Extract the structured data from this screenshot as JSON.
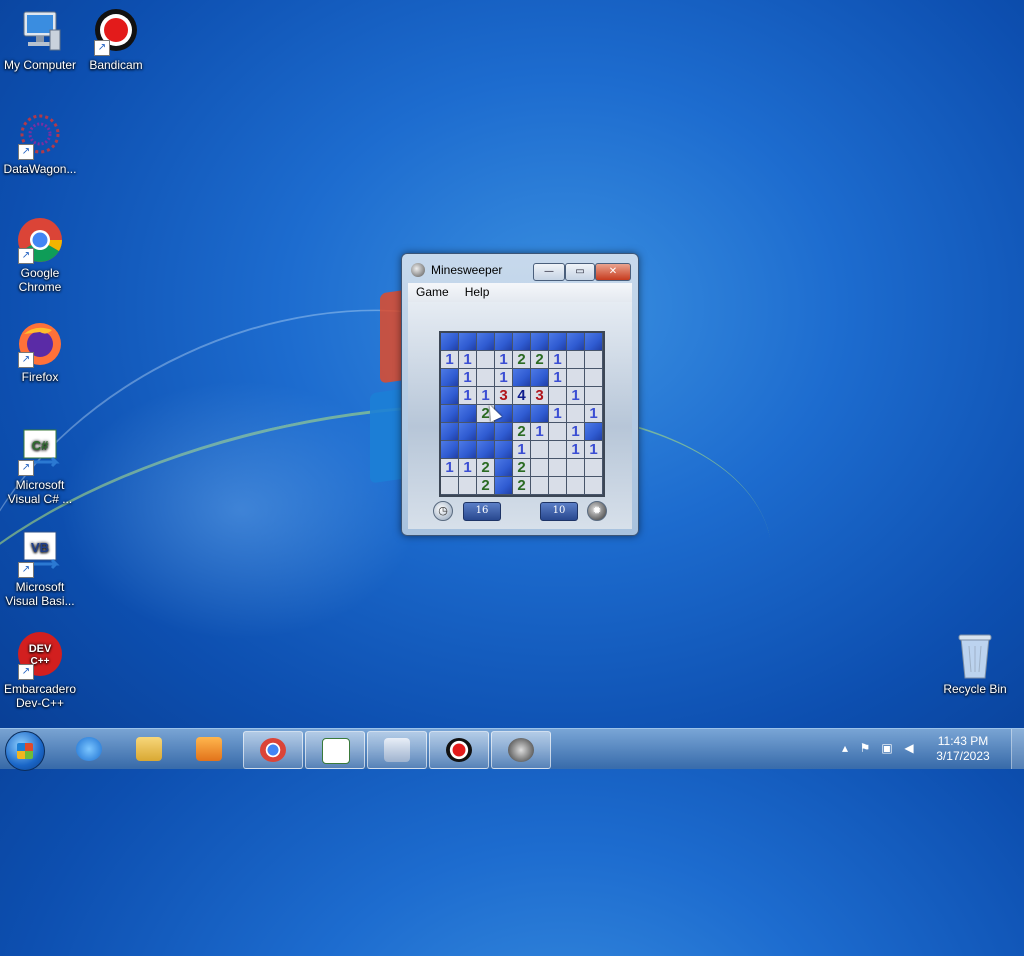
{
  "desktop": {
    "icons": [
      {
        "label": "My Computer",
        "icon": "computer-icon"
      },
      {
        "label": "Bandicam",
        "icon": "bandicam-icon"
      },
      {
        "label": "DataWagon...",
        "icon": "datawagon-icon"
      },
      {
        "label": "Google Chrome",
        "icon": "chrome-icon"
      },
      {
        "label": "Firefox",
        "icon": "firefox-icon"
      },
      {
        "label": "Microsoft Visual C# ...",
        "icon": "visual-csharp-icon"
      },
      {
        "label": "Microsoft Visual Basi...",
        "icon": "visual-basic-icon"
      },
      {
        "label": "Embarcadero Dev-C++",
        "icon": "devcpp-icon"
      },
      {
        "label": "Recycle Bin",
        "icon": "recycle-bin-icon"
      }
    ],
    "badge_csharp": "C#",
    "badge_vb": "VB",
    "badge_dev": "DEV C++"
  },
  "window": {
    "title": "Minesweeper",
    "min_glyph": "—",
    "max_glyph": "▭",
    "close_glyph": "✕",
    "menu": [
      "Game",
      "Help"
    ]
  },
  "game": {
    "rows": [
      "#########",
      "11.1221..",
      "#1.1##1..",
      "#11343 1.",
      "##2###1.11",
      "####21.1#",
      "####1..11",
      "112#2....",
      "..2#2...."
    ],
    "time": "16",
    "mines_left": "10"
  },
  "taskbar": {
    "apps": [
      "ie-icon",
      "explorer-icon",
      "media-player-icon",
      "chrome-icon",
      "visual-csharp-icon",
      "keyboard-icon",
      "bandicam-icon",
      "minesweeper-icon"
    ],
    "active_apps": [
      "chrome-icon",
      "visual-csharp-icon",
      "keyboard-icon",
      "bandicam-icon",
      "minesweeper-icon"
    ],
    "time": "11:43 PM",
    "date": "3/17/2023"
  },
  "colors": {
    "desktop": "#1d6ccf",
    "covered_cell": "#3560d4",
    "open_cell": "#d9dee8"
  }
}
